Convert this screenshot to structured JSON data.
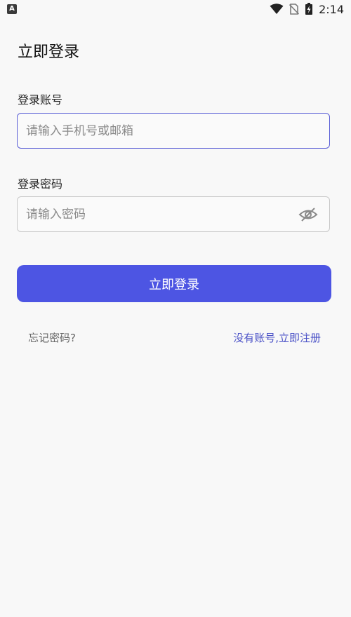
{
  "status_bar": {
    "left_icon": "A",
    "icons": [
      "wifi-icon",
      "no-sim-icon",
      "battery-charging-icon"
    ],
    "time": "2:14"
  },
  "page": {
    "title": "立即登录"
  },
  "form": {
    "account_label": "登录账号",
    "account_placeholder": "请输入手机号或邮箱",
    "account_value": "",
    "password_label": "登录密码",
    "password_placeholder": "请输入密码",
    "password_value": "",
    "password_visibility_icon": "eye-off-icon",
    "submit_label": "立即登录"
  },
  "links": {
    "forgot_password": "忘记密码?",
    "register": "没有账号,立即注册"
  },
  "colors": {
    "accent": "#4d55e3",
    "link": "#4b52c7",
    "background": "#f8f8f8"
  }
}
